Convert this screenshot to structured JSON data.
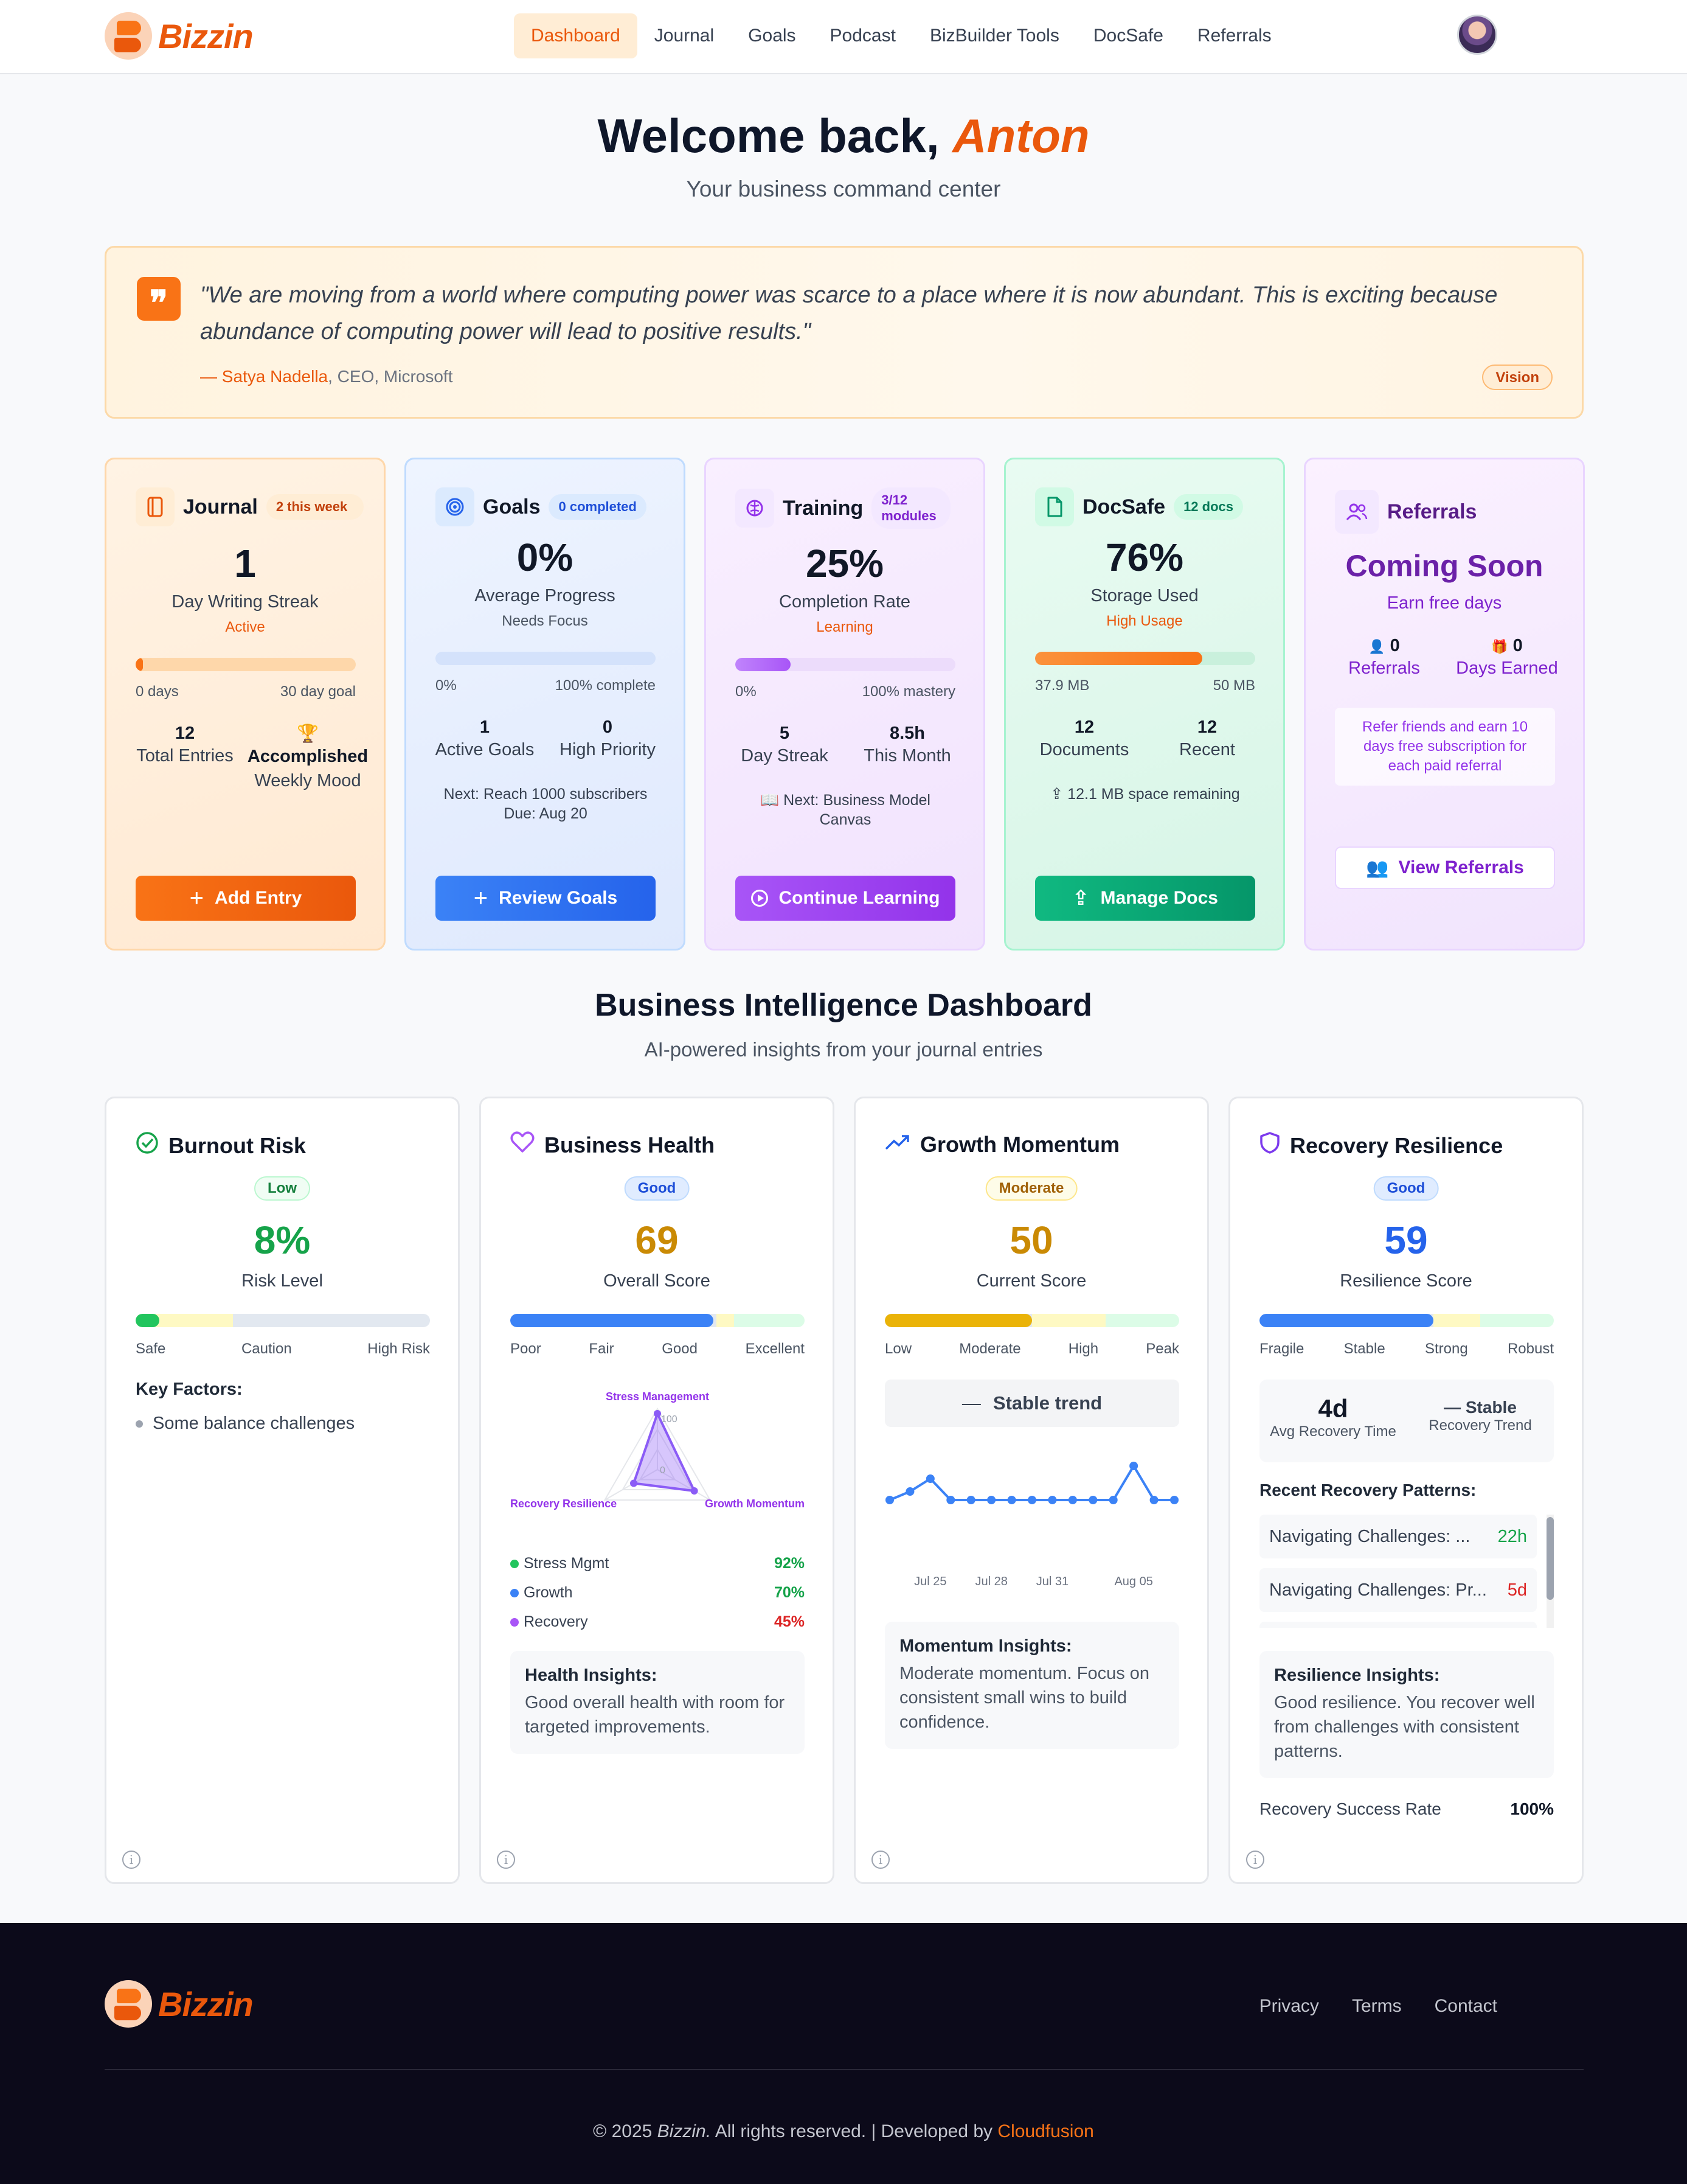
{
  "brand": {
    "name": "Bizzin",
    "accent": "#ea580c"
  },
  "nav": {
    "items": [
      {
        "label": "Dashboard",
        "active": true
      },
      {
        "label": "Journal"
      },
      {
        "label": "Goals"
      },
      {
        "label": "Podcast"
      },
      {
        "label": "BizBuilder Tools"
      },
      {
        "label": "DocSafe"
      },
      {
        "label": "Referrals"
      }
    ]
  },
  "hero": {
    "greeting": "Welcome back,",
    "name": "Anton",
    "subtitle": "Your business command center"
  },
  "quote": {
    "text": "\"We are moving from a world where computing power was scarce to a place where it is now abundant. This is exciting because abundance of computing power will lead to positive results.\"",
    "author": "— Satya Nadella",
    "role": ", CEO, Microsoft",
    "tag": "Vision"
  },
  "cards": {
    "journal": {
      "title": "Journal",
      "badge": "2 this week",
      "value": "1",
      "label": "Day Writing Streak",
      "status": "Active",
      "progress": 0.033,
      "scale_start": "0 days",
      "scale_end": "30 day goal",
      "stat1_value": "12",
      "stat1_label": "Total Entries",
      "stat2_icon": "trophy-icon",
      "stat2_value": "Accomplished",
      "stat2_label": "Weekly Mood",
      "button": "Add Entry"
    },
    "goals": {
      "title": "Goals",
      "badge": "0 completed",
      "value": "0%",
      "label": "Average Progress",
      "status": "Needs Focus",
      "progress": 0,
      "scale_start": "0%",
      "scale_end": "100% complete",
      "stat1_value": "1",
      "stat1_label": "Active Goals",
      "stat2_value": "0",
      "stat2_label": "High Priority",
      "note1": "Next: Reach 1000 subscribers",
      "note2": "Due: Aug 20",
      "button": "Review Goals"
    },
    "training": {
      "title": "Training",
      "badge": "3/12 modules",
      "value": "25%",
      "label": "Completion Rate",
      "status": "Learning",
      "progress": 0.25,
      "scale_start": "0%",
      "scale_end": "100% mastery",
      "stat1_value": "5",
      "stat1_label": "Day Streak",
      "stat2_value": "8.5h",
      "stat2_label": "This Month",
      "note": "Next: Business Model Canvas",
      "button": "Continue Learning"
    },
    "docsafe": {
      "title": "DocSafe",
      "badge": "12 docs",
      "value": "76%",
      "label": "Storage Used",
      "status": "High Usage",
      "progress": 0.76,
      "scale_start": "37.9 MB",
      "scale_end": "50 MB",
      "stat1_value": "12",
      "stat1_label": "Documents",
      "stat2_value": "12",
      "stat2_label": "Recent",
      "note": "12.1 MB space remaining",
      "button": "Manage Docs"
    },
    "referrals": {
      "title": "Referrals",
      "headline": "Coming Soon",
      "sub": "Earn free days",
      "stat1_value": "0",
      "stat1_label": "Referrals",
      "stat2_value": "0",
      "stat2_label": "Days Earned",
      "note": "Refer friends and earn 10 days free subscription for each paid referral",
      "button": "View Referrals"
    }
  },
  "section": {
    "title": "Business Intelligence Dashboard",
    "subtitle": "AI-powered insights from your journal entries"
  },
  "bi": {
    "burnout": {
      "title": "Burnout Risk",
      "tag": "Low",
      "value": "8%",
      "label": "Risk Level",
      "progress": 0.08,
      "scale": [
        "Safe",
        "Caution",
        "High Risk"
      ],
      "factors_title": "Key Factors:",
      "factors": [
        "Some balance challenges"
      ]
    },
    "health": {
      "title": "Business Health",
      "tag": "Good",
      "value": "69",
      "label": "Overall Score",
      "progress": 0.69,
      "scale": [
        "Poor",
        "Fair",
        "Good",
        "Excellent"
      ],
      "radar": {
        "axes": [
          "Stress Management",
          "Growth Momentum",
          "Recovery Resilience"
        ],
        "values": [
          92,
          70,
          45
        ],
        "max": 100,
        "ticks": [
          "100",
          "0"
        ]
      },
      "metrics": [
        {
          "label": "Stress Mgmt",
          "value": "92%",
          "dot": "#22c55e",
          "color": "#16a34a"
        },
        {
          "label": "Growth",
          "value": "70%",
          "dot": "#3b82f6",
          "color": "#16a34a"
        },
        {
          "label": "Recovery",
          "value": "45%",
          "dot": "#a855f7",
          "color": "#dc2626"
        }
      ],
      "insight_title": "Health Insights:",
      "insight": "Good overall health with room for targeted improvements."
    },
    "growth": {
      "title": "Growth Momentum",
      "tag": "Moderate",
      "value": "50",
      "label": "Current Score",
      "progress": 0.5,
      "scale": [
        "Low",
        "Moderate",
        "High",
        "Peak"
      ],
      "trend": "Stable trend",
      "chart_data": {
        "type": "line",
        "x": [
          "",
          "",
          "Jul 25",
          "",
          "",
          "Jul 28",
          "",
          "",
          "Jul 31",
          "",
          "",
          "",
          "Aug 05",
          "",
          ""
        ],
        "y": [
          50,
          52,
          55,
          50,
          50,
          50,
          50,
          50,
          50,
          50,
          50,
          50,
          58,
          50,
          50
        ],
        "tick_labels": [
          "Jul 25",
          "Jul 28",
          "Jul 31",
          "Aug 05"
        ]
      },
      "insight_title": "Momentum Insights:",
      "insight": "Moderate momentum. Focus on consistent small wins to build confidence."
    },
    "recovery": {
      "title": "Recovery Resilience",
      "tag": "Good",
      "value": "59",
      "label": "Resilience Score",
      "progress": 0.59,
      "scale": [
        "Fragile",
        "Stable",
        "Strong",
        "Robust"
      ],
      "avg_value": "4d",
      "avg_label": "Avg Recovery Time",
      "trend_value": "Stable",
      "trend_label": "Recovery Trend",
      "patterns_title": "Recent Recovery Patterns:",
      "patterns": [
        {
          "label": "Navigating Challenges: ...",
          "value": "22h",
          "color": "#16a34a"
        },
        {
          "label": "Navigating Challenges: Pr...",
          "value": "5d",
          "color": "#dc2626"
        }
      ],
      "insight_title": "Resilience Insights:",
      "insight": "Good resilience. You recover well from challenges with consistent patterns.",
      "success_label": "Recovery Success Rate",
      "success_value": "100%"
    }
  },
  "footer": {
    "links": [
      "Privacy",
      "Terms",
      "Contact"
    ],
    "copyright_pre": "© 2025",
    "copyright_brand": "Bizzin.",
    "copyright_mid": "All rights reserved. | Developed by",
    "developer": "Cloudfusion"
  }
}
